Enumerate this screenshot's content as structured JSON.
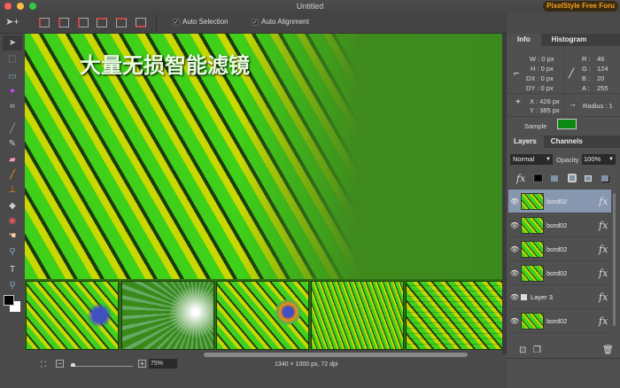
{
  "window": {
    "title": "Untitled",
    "badge": "PixelStyle Free Foru"
  },
  "toolbar": {
    "auto_selection": "Auto Selection",
    "auto_alignment": "Auto Alignment"
  },
  "canvas": {
    "overlay_text": "大量无损智能滤镜"
  },
  "status": {
    "zoom": "75%",
    "dimensions": "1340 × 1000 px, 72 dpi"
  },
  "info": {
    "tabs": [
      "Info",
      "Histogram"
    ],
    "w": "W : 0 px",
    "h": "H : 0 px",
    "dx": "DX : 0 px",
    "dy": "DY : 0 px",
    "r": "R :",
    "r_val": "46",
    "g": "G :",
    "g_val": "124",
    "b": "B :",
    "b_val": "20",
    "a": "A :",
    "a_val": "255",
    "x": "X : 426 px",
    "y": "Y : 385 px",
    "radius": "Radius : 1",
    "sample": "Sample",
    "sample_color": "#0a8a10"
  },
  "layers": {
    "tabs": [
      "Layers",
      "Channels"
    ],
    "blend": "Normal",
    "opacity_label": "Opacity",
    "opacity": "100%",
    "fx_label": "fx",
    "items": [
      {
        "name": "bord02",
        "selected": true
      },
      {
        "name": "bord02"
      },
      {
        "name": "bord02"
      },
      {
        "name": "bord02"
      },
      {
        "name": "Layer 3"
      },
      {
        "name": "bord02"
      }
    ]
  }
}
